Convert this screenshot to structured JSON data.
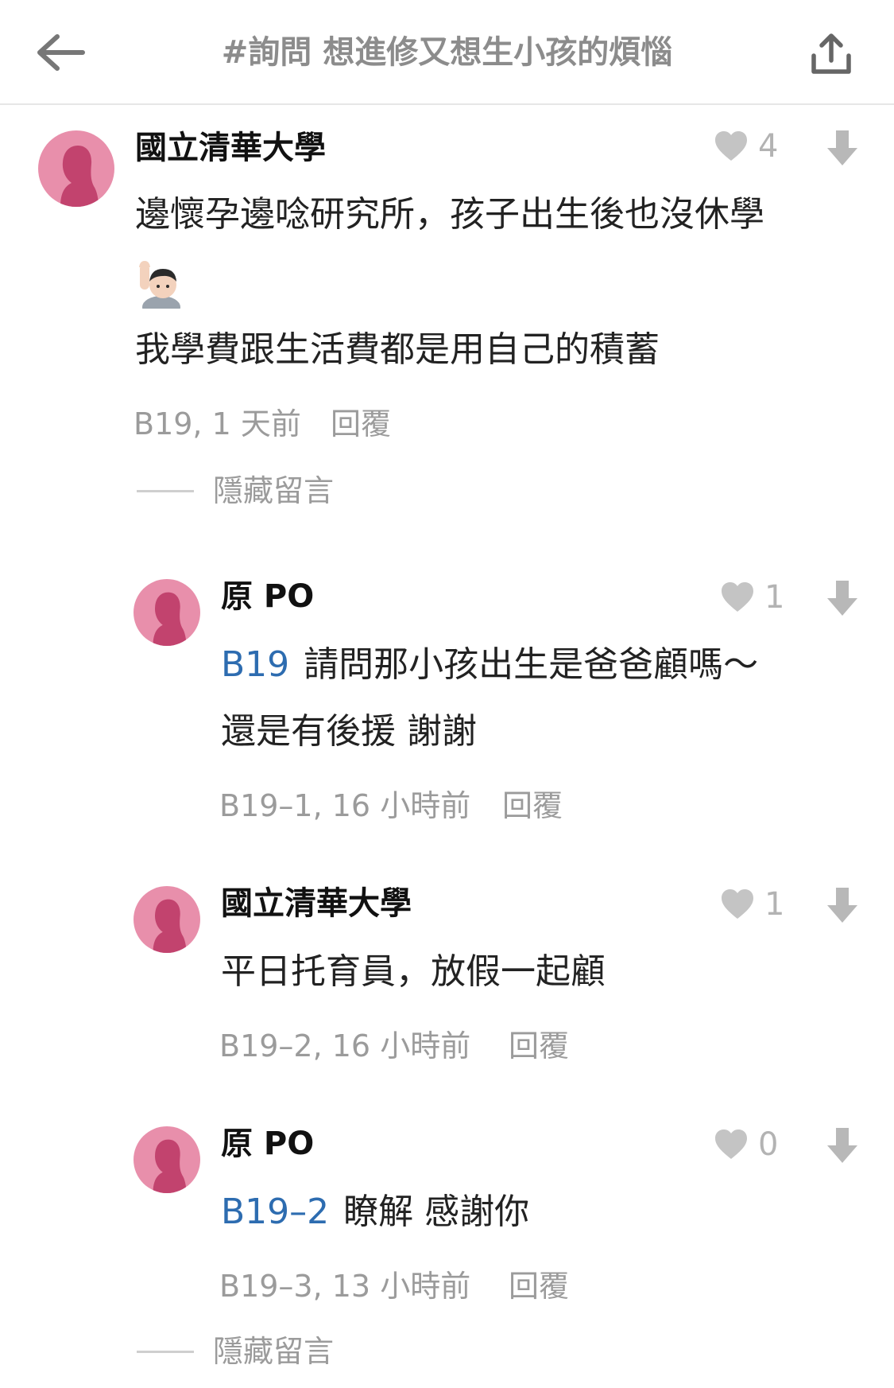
{
  "header": {
    "title": "#詢問 想進修又想生小孩的煩惱",
    "back_icon": "back-arrow-icon",
    "share_icon": "share-icon"
  },
  "colors": {
    "avatar": "#e88fab",
    "avatar_silhouette": "#c2436e",
    "mention": "#2d6cb0",
    "meta": "#9b9b9b"
  },
  "comments": [
    {
      "author": "國立清華大學",
      "likes": "4",
      "body_line1": "邊懷孕邊唸研究所，孩子出生後也沒休學",
      "body_emoji": "person-raising-hand-emoji",
      "body_line2": "我學費跟生活費都是用自己的積蓄",
      "meta": "B19, 1 天前",
      "reply": "回覆",
      "hide": "隱藏留言"
    },
    {
      "author": "原 PO",
      "likes": "1",
      "mention": "B19",
      "body_line1": "請問那小孩出生是爸爸顧嗎～",
      "body_line2": "還是有後援 謝謝",
      "meta": "B19–1, 16 小時前",
      "reply": "回覆"
    },
    {
      "author": "國立清華大學",
      "likes": "1",
      "body_line1": "平日托育員，放假一起顧",
      "meta": "B19–2, 16 小時前",
      "reply": "回覆"
    },
    {
      "author": "原 PO",
      "likes": "0",
      "mention": "B19–2",
      "body_line1": "瞭解 感謝你",
      "meta": "B19–3, 13 小時前",
      "reply": "回覆",
      "hide": "隱藏留言"
    }
  ]
}
